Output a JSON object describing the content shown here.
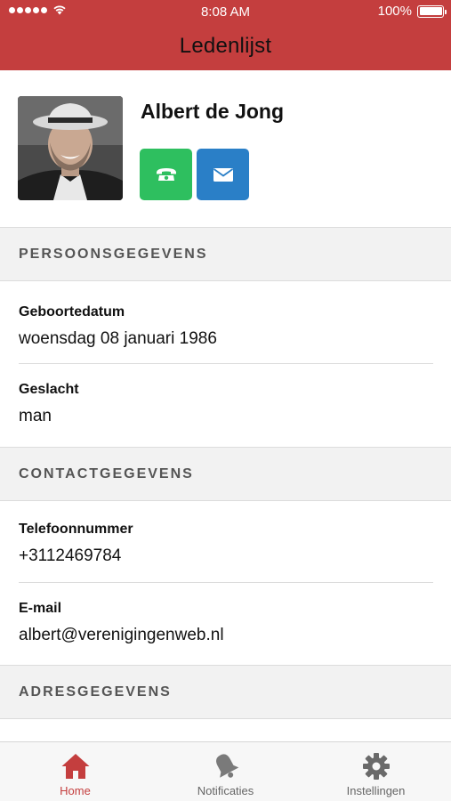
{
  "status_bar": {
    "time": "8:08 AM",
    "battery": "100%",
    "battery_level": 1.0
  },
  "nav": {
    "title": "Ledenlijst"
  },
  "profile": {
    "name": "Albert de Jong",
    "actions": [
      {
        "icon": "phone-icon",
        "color": "#2ebf5f"
      },
      {
        "icon": "envelope-icon",
        "color": "#2a7fc7"
      }
    ]
  },
  "sections": {
    "personal": {
      "title": "PERSOONSGEGEVENS",
      "fields": [
        {
          "label": "Geboortedatum",
          "value": "woensdag 08 januari 1986"
        },
        {
          "label": "Geslacht",
          "value": "man"
        }
      ]
    },
    "contact": {
      "title": "CONTACTGEGEVENS",
      "fields": [
        {
          "label": "Telefoonnummer",
          "value": "+3112469784"
        },
        {
          "label": "E-mail",
          "value": "albert@verenigingenweb.nl"
        }
      ]
    },
    "address": {
      "title": "ADRESGEGEVENS"
    }
  },
  "tabs": [
    {
      "label": "Home",
      "icon": "home-icon",
      "active": true
    },
    {
      "label": "Notificaties",
      "icon": "bell-icon",
      "active": false
    },
    {
      "label": "Instellingen",
      "icon": "gear-icon",
      "active": false
    }
  ],
  "colors": {
    "header": "#c43e3e",
    "accent": "#c43e3e",
    "tab_inactive": "#666666"
  }
}
